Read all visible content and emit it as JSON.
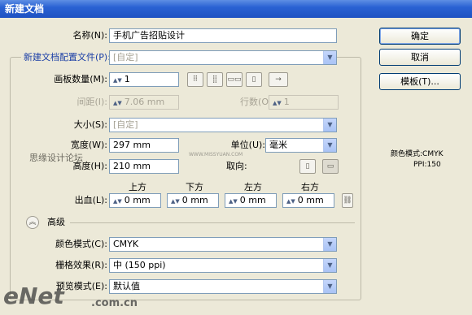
{
  "window": {
    "title": "新建文档"
  },
  "buttons": {
    "ok": "确定",
    "cancel": "取消",
    "templates": "模板(T)..."
  },
  "fields": {
    "name_label": "名称(N):",
    "name_value": "手机广告招贴设计",
    "profile_label": "新建文档配置文件(P):",
    "profile_value": "[自定]",
    "artboards_label": "画板数量(M):",
    "artboards_value": "1",
    "spacing_label": "间距(I):",
    "spacing_value": "7.06 mm",
    "rows_label": "行数(O):",
    "rows_value": "1",
    "size_label": "大小(S):",
    "size_value": "[自定]",
    "width_label": "宽度(W):",
    "width_value": "297 mm",
    "height_label": "高度(H):",
    "height_value": "210 mm",
    "units_label": "单位(U):",
    "units_value": "毫米",
    "orientation_label": "取向:",
    "bleed_label": "出血(L):",
    "bleed_top_label": "上方",
    "bleed_bottom_label": "下方",
    "bleed_left_label": "左方",
    "bleed_right_label": "右方",
    "bleed_top": "0 mm",
    "bleed_bottom": "0 mm",
    "bleed_left": "0 mm",
    "bleed_right": "0 mm",
    "advanced_label": "高级",
    "color_mode_label": "颜色模式(C):",
    "color_mode_value": "CMYK",
    "raster_label": "栅格效果(R):",
    "raster_value": "中 (150 ppi)",
    "preview_label": "预览模式(E):",
    "preview_value": "默认值"
  },
  "info": {
    "color_mode": "颜色模式:CMYK",
    "ppi": "PPI:150"
  },
  "watermarks": {
    "site_text": "思缘设计论坛",
    "site_url": "WWW.MISSYUAN.COM",
    "logo": "eNet",
    "logo_domain": ".com.cn"
  },
  "icons": {
    "arrange_grid_by_row": "grid-row-icon",
    "arrange_grid_by_col": "grid-col-icon",
    "arrange_row": "row-icon",
    "arrange_col": "column-icon",
    "layout_direction": "arrow-right-icon",
    "portrait": "portrait-icon",
    "landscape": "landscape-icon",
    "link_bleed": "chain-link-icon",
    "expand_advanced": "chevron-up-icon"
  }
}
